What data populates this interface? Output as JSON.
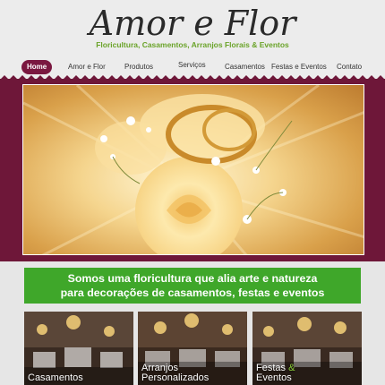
{
  "header": {
    "title": "Amor e Flor",
    "subtitle": "Floricultura, Casamentos, Arranjos Florais & Eventos"
  },
  "nav": {
    "items": [
      {
        "label": "Home"
      },
      {
        "label": "Amor e Flor"
      },
      {
        "label": "Produtos"
      },
      {
        "label": "Serviços"
      },
      {
        "label": "Casamentos"
      },
      {
        "label": "Festas e Eventos"
      },
      {
        "label": "Contato"
      }
    ]
  },
  "tagline": {
    "line1": "Somos uma floricultura que alia arte e natureza",
    "line2": "para decorações de casamentos, festas e eventos"
  },
  "cards": [
    {
      "line1": "Casamentos",
      "line2": ""
    },
    {
      "line1": "Arranjos",
      "line2": "Personalizados"
    },
    {
      "line1": "Festas",
      "amp": "&",
      "line2": "Eventos"
    }
  ],
  "colors": {
    "brand": "#6e1739",
    "accent": "#3fa72a",
    "subtitle": "#6aa329"
  }
}
